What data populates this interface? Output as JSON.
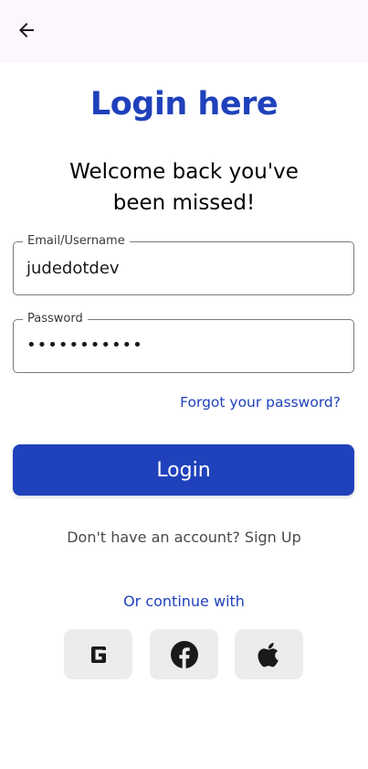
{
  "appbar": {
    "back_icon": "arrow-left-icon"
  },
  "title": "Login here",
  "subtitle": "Welcome back you've been missed!",
  "email": {
    "label": "Email/Username",
    "value": "judedotdev"
  },
  "password": {
    "label": "Password",
    "value": "•••••••••••"
  },
  "forgot_label": "Forgot your password?",
  "login_label": "Login",
  "signup_label": "Don't have an account? Sign Up",
  "or_continue_label": "Or continue with",
  "social": [
    {
      "name": "google",
      "icon": "google-icon"
    },
    {
      "name": "facebook",
      "icon": "facebook-icon"
    },
    {
      "name": "apple",
      "icon": "apple-icon"
    }
  ],
  "colors": {
    "primary": "#1f41bb",
    "appbar_bg": "#fdf6fd",
    "social_bg": "#ececec"
  }
}
